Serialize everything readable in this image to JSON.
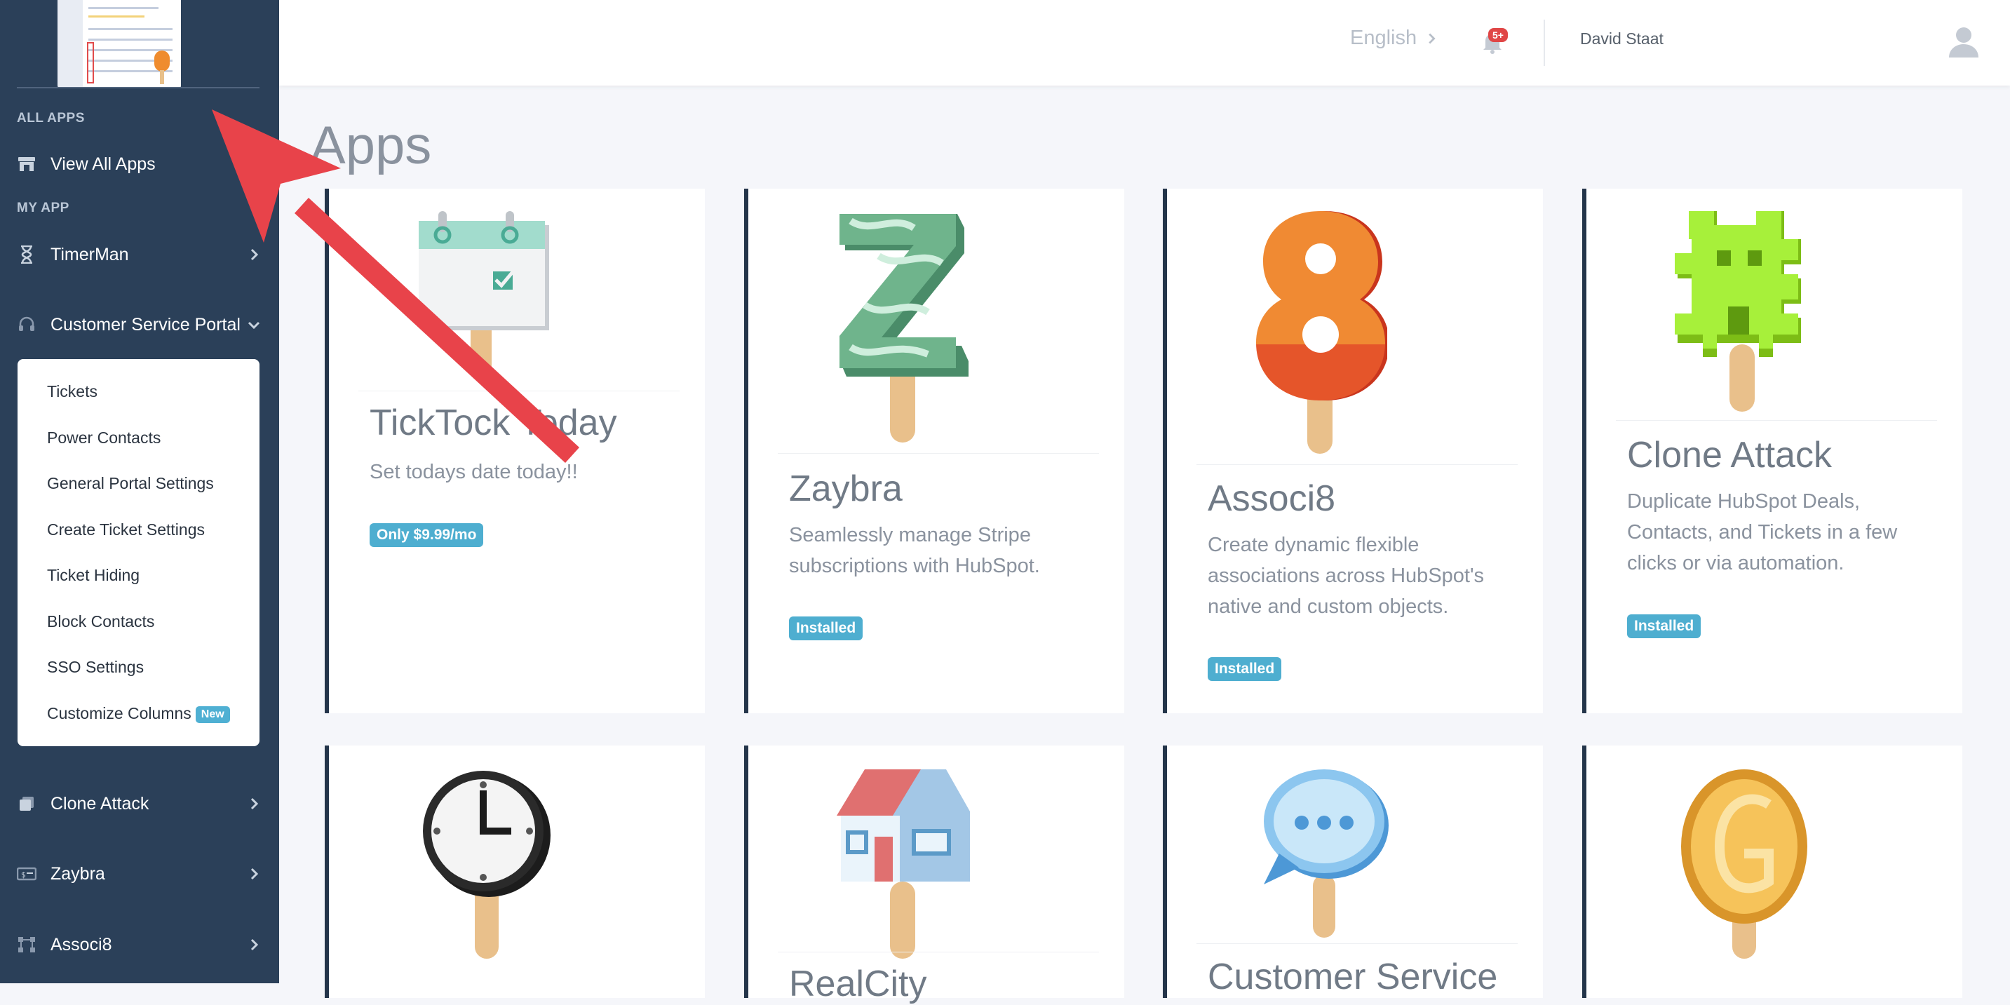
{
  "sidebar": {
    "section_all_apps": "ALL APPS",
    "view_all_apps": "View All Apps",
    "section_my_app": "MY APP",
    "items": [
      {
        "label": "TimerMan",
        "icon": "hourglass-icon"
      },
      {
        "label": "Customer Service Portal",
        "icon": "headset-icon"
      },
      {
        "label": "Clone Attack",
        "icon": "copy-icon"
      },
      {
        "label": "Zaybra",
        "icon": "money-icon"
      },
      {
        "label": "Associ8",
        "icon": "nodes-icon"
      }
    ],
    "submenu": [
      "Tickets",
      "Power Contacts",
      "General Portal Settings",
      "Create Ticket Settings",
      "Ticket Hiding",
      "Block Contacts",
      "SSO Settings",
      "Customize Columns"
    ],
    "submenu_new_badge": "New"
  },
  "topbar": {
    "language": "English",
    "notification_count": "5+",
    "user_name": "David Staat"
  },
  "main": {
    "title": "Apps",
    "cards": [
      {
        "name": "TickTock Today",
        "description": "Set todays date today!!",
        "badge": "Only $9.99/mo",
        "icon": "calendar-popsicle-icon"
      },
      {
        "name": "Zaybra",
        "description": "Seamlessly manage Stripe subscriptions with HubSpot.",
        "badge": "Installed",
        "icon": "zebra-z-popsicle-icon"
      },
      {
        "name": "Associ8",
        "description": "Create dynamic flexible associations across HubSpot's native and custom objects.",
        "badge": "Installed",
        "icon": "number-8-popsicle-icon"
      },
      {
        "name": "Clone Attack",
        "description": "Duplicate HubSpot Deals, Contacts, and Tickets in a few clicks or via automation.",
        "badge": "Installed",
        "icon": "pixel-invader-popsicle-icon"
      },
      {
        "name": "",
        "icon": "clock-popsicle-icon"
      },
      {
        "name": "RealCity",
        "icon": "house-popsicle-icon"
      },
      {
        "name": "Customer Service",
        "icon": "chat-bubble-popsicle-icon"
      },
      {
        "name": "",
        "icon": "gold-coin-popsicle-icon"
      }
    ]
  },
  "annotation": {
    "color": "#e8434a",
    "icon": "red-arrow-annotation"
  },
  "colors": {
    "sidebar": "#2b4059",
    "badge": "#4eaed0",
    "card_border": "#24354a"
  }
}
